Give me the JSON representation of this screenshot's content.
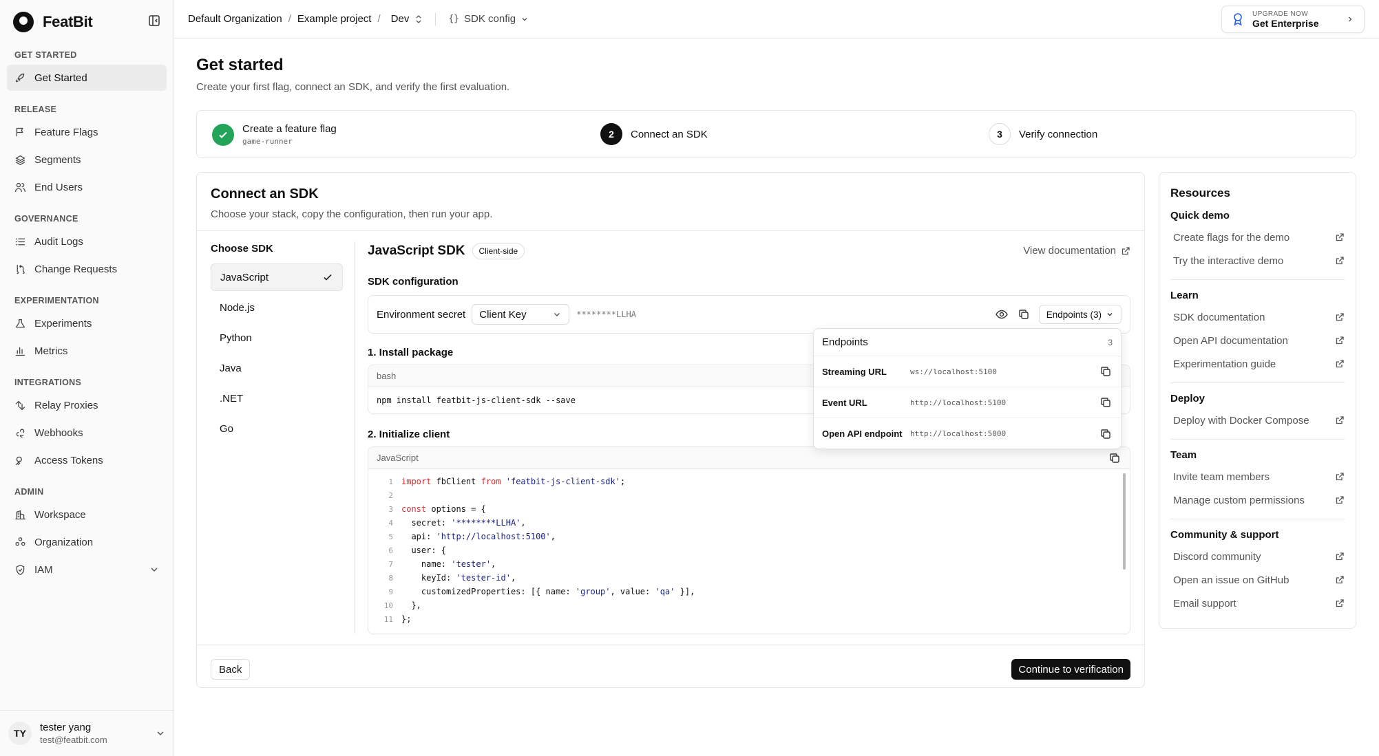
{
  "app": {
    "name": "FeatBit"
  },
  "sidebar": {
    "sections": [
      {
        "title": "GET STARTED",
        "items": [
          {
            "label": "Get Started",
            "icon": "rocket-icon",
            "active": true
          }
        ]
      },
      {
        "title": "RELEASE",
        "items": [
          {
            "label": "Feature Flags",
            "icon": "flag-icon"
          },
          {
            "label": "Segments",
            "icon": "layers-icon"
          },
          {
            "label": "End Users",
            "icon": "users-icon"
          }
        ]
      },
      {
        "title": "GOVERNANCE",
        "items": [
          {
            "label": "Audit Logs",
            "icon": "list-icon"
          },
          {
            "label": "Change Requests",
            "icon": "git-pull-request-icon"
          }
        ]
      },
      {
        "title": "EXPERIMENTATION",
        "items": [
          {
            "label": "Experiments",
            "icon": "flask-icon"
          },
          {
            "label": "Metrics",
            "icon": "bar-chart-icon"
          }
        ]
      },
      {
        "title": "INTEGRATIONS",
        "items": [
          {
            "label": "Relay Proxies",
            "icon": "relay-icon"
          },
          {
            "label": "Webhooks",
            "icon": "webhook-icon"
          },
          {
            "label": "Access Tokens",
            "icon": "key-icon"
          }
        ]
      },
      {
        "title": "ADMIN",
        "items": [
          {
            "label": "Workspace",
            "icon": "building-icon"
          },
          {
            "label": "Organization",
            "icon": "org-icon"
          },
          {
            "label": "IAM",
            "icon": "shield-icon",
            "expandable": true
          }
        ]
      }
    ],
    "user": {
      "initials": "TY",
      "name": "tester yang",
      "email": "test@featbit.com"
    }
  },
  "topbar": {
    "org": "Default Organization",
    "project": "Example project",
    "env": "Dev",
    "sdk_config": "SDK config",
    "upgrade_small": "UPGRADE NOW",
    "upgrade_big": "Get Enterprise"
  },
  "page": {
    "title": "Get started",
    "subtitle": "Create your first flag, connect an SDK, and verify the first evaluation."
  },
  "steps": [
    {
      "number": "",
      "title": "Create a feature flag",
      "sub": "game-runner",
      "state": "done"
    },
    {
      "number": "2",
      "title": "Connect an SDK",
      "sub": "",
      "state": "active"
    },
    {
      "number": "3",
      "title": "Verify connection",
      "sub": "",
      "state": "idle"
    }
  ],
  "connect": {
    "title": "Connect an SDK",
    "subtitle": "Choose your stack, copy the configuration, then run your app.",
    "choose_label": "Choose SDK",
    "sdks": [
      "JavaScript",
      "Node.js",
      "Python",
      "Java",
      ".NET",
      "Go"
    ],
    "selected_sdk": "JavaScript",
    "sdk_title": "JavaScript SDK",
    "sdk_badge": "Client-side",
    "view_doc": "View documentation",
    "config_label": "SDK configuration",
    "env_secret_label": "Environment secret",
    "key_select": "Client Key",
    "secret_masked": "********LLHA",
    "endpoints_btn": "Endpoints (3)",
    "install_label": "1. Install package",
    "install_lang": "bash",
    "install_cmd": "npm install featbit-js-client-sdk --save",
    "init_label": "2. Initialize client",
    "init_lang": "JavaScript",
    "back": "Back",
    "continue": "Continue to verification"
  },
  "code_lines": [
    {
      "n": "1",
      "parts": [
        {
          "t": "import",
          "c": "kw"
        },
        {
          "t": " fbClient ",
          "c": ""
        },
        {
          "t": "from",
          "c": "kw"
        },
        {
          "t": " ",
          "c": ""
        },
        {
          "t": "'featbit-js-client-sdk'",
          "c": "str"
        },
        {
          "t": ";",
          "c": ""
        }
      ]
    },
    {
      "n": "2",
      "parts": []
    },
    {
      "n": "3",
      "parts": [
        {
          "t": "const",
          "c": "kw"
        },
        {
          "t": " options = {",
          "c": ""
        }
      ]
    },
    {
      "n": "4",
      "parts": [
        {
          "t": "  secret: ",
          "c": ""
        },
        {
          "t": "'********LLHA'",
          "c": "str"
        },
        {
          "t": ",",
          "c": ""
        }
      ]
    },
    {
      "n": "5",
      "parts": [
        {
          "t": "  api: ",
          "c": ""
        },
        {
          "t": "'http://localhost:5100'",
          "c": "str"
        },
        {
          "t": ",",
          "c": ""
        }
      ]
    },
    {
      "n": "6",
      "parts": [
        {
          "t": "  user: {",
          "c": ""
        }
      ]
    },
    {
      "n": "7",
      "parts": [
        {
          "t": "    name: ",
          "c": ""
        },
        {
          "t": "'tester'",
          "c": "str"
        },
        {
          "t": ",",
          "c": ""
        }
      ]
    },
    {
      "n": "8",
      "parts": [
        {
          "t": "    keyId: ",
          "c": ""
        },
        {
          "t": "'tester-id'",
          "c": "str"
        },
        {
          "t": ",",
          "c": ""
        }
      ]
    },
    {
      "n": "9",
      "parts": [
        {
          "t": "    customizedProperties: [{ name: ",
          "c": ""
        },
        {
          "t": "'group'",
          "c": "str"
        },
        {
          "t": ", value: ",
          "c": ""
        },
        {
          "t": "'qa'",
          "c": "str"
        },
        {
          "t": " }],",
          "c": ""
        }
      ]
    },
    {
      "n": "10",
      "parts": [
        {
          "t": "  },",
          "c": ""
        }
      ]
    },
    {
      "n": "11",
      "parts": [
        {
          "t": "};",
          "c": ""
        }
      ]
    }
  ],
  "endpoints": {
    "title": "Endpoints",
    "count": "3",
    "rows": [
      {
        "label": "Streaming URL",
        "value": "ws://localhost:5100"
      },
      {
        "label": "Event URL",
        "value": "http://localhost:5100"
      },
      {
        "label": "Open API endpoint",
        "value": "http://localhost:5000"
      }
    ]
  },
  "resources": {
    "title": "Resources",
    "groups": [
      {
        "title": "Quick demo",
        "links": [
          "Create flags for the demo",
          "Try the interactive demo"
        ]
      },
      {
        "title": "Learn",
        "links": [
          "SDK documentation",
          "Open API documentation",
          "Experimentation guide"
        ]
      },
      {
        "title": "Deploy",
        "links": [
          "Deploy with Docker Compose"
        ]
      },
      {
        "title": "Team",
        "links": [
          "Invite team members",
          "Manage custom permissions"
        ]
      },
      {
        "title": "Community & support",
        "links": [
          "Discord community",
          "Open an issue on GitHub",
          "Email support"
        ]
      }
    ]
  },
  "colors": {
    "success": "#22a559",
    "primary": "#111111",
    "code_keyword": "#d32f2f",
    "code_string": "#1a237e"
  }
}
